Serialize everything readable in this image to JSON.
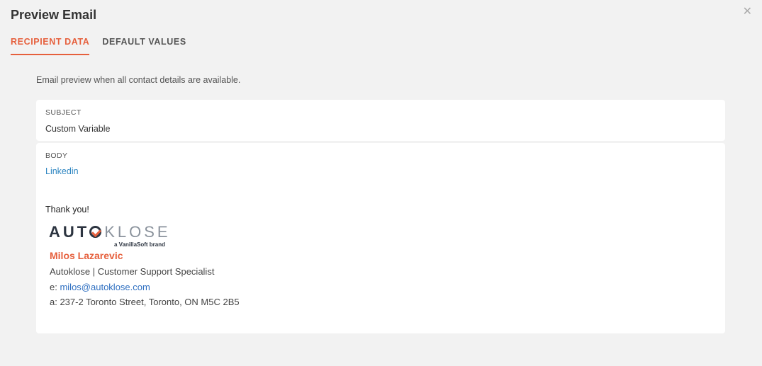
{
  "dialog": {
    "title": "Preview Email",
    "close_icon": "close-icon"
  },
  "tabs": [
    {
      "label": "RECIPIENT DATA",
      "active": true
    },
    {
      "label": "DEFAULT VALUES",
      "active": false
    }
  ],
  "intro": "Email preview when all contact details are available.",
  "subject": {
    "label": "SUBJECT",
    "value": "Custom Variable"
  },
  "body": {
    "label": "BODY",
    "link_text": "Linkedin",
    "thanks": "Thank you!",
    "logo": {
      "word_dark": "AUT",
      "word_light": "KLOSE",
      "tagline": "a VanillaSoft brand"
    },
    "signature": {
      "name": "Milos Lazarevic",
      "role": "Autoklose | Customer Support Specialist",
      "email_prefix": "e: ",
      "email": "milos@autoklose.com",
      "address": "a: 237-2 Toronto Street, Toronto, ON M5C 2B5"
    }
  },
  "colors": {
    "accent": "#e6603d",
    "link": "#2e86c1",
    "background": "#f2f2f2"
  }
}
